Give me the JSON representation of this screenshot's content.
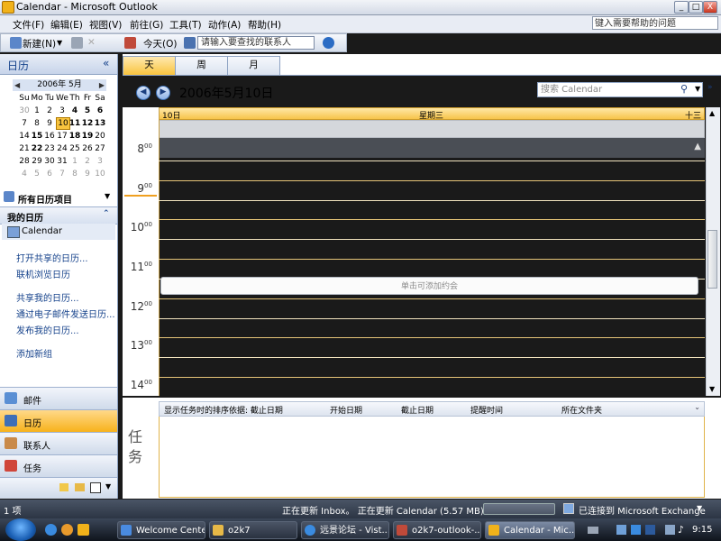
{
  "window": {
    "title": "Calendar - Microsoft Outlook",
    "minimize": "_",
    "maximize": "□",
    "close": "X"
  },
  "menu": {
    "items": [
      "文件(F)",
      "编辑(E)",
      "视图(V)",
      "前往(G)",
      "工具(T)",
      "动作(A)",
      "帮助(H)"
    ],
    "help_placeholder": "键入需要帮助的问题"
  },
  "toolbar": {
    "new_label": "新建(N)",
    "today_label": "今天(O)",
    "contact_placeholder": "请输入要查找的联系人"
  },
  "nav": {
    "title": "日历",
    "collapse_icon": "«",
    "mini_calendar": {
      "month": "2006年 5月",
      "weekdays": [
        "Su",
        "Mo",
        "Tu",
        "We",
        "Th",
        "Fr",
        "Sa"
      ],
      "weeks": [
        [
          "30",
          "1",
          "2",
          "3",
          "4",
          "5",
          "6"
        ],
        [
          "7",
          "8",
          "9",
          "10",
          "11",
          "12",
          "13"
        ],
        [
          "14",
          "15",
          "16",
          "17",
          "18",
          "19",
          "20"
        ],
        [
          "21",
          "22",
          "23",
          "24",
          "25",
          "26",
          "27"
        ],
        [
          "28",
          "29",
          "30",
          "31",
          "1",
          "2",
          "3"
        ],
        [
          "4",
          "5",
          "6",
          "7",
          "8",
          "9",
          "10"
        ]
      ],
      "selected": "10"
    },
    "all_items": "所有日历项目",
    "my_calendars": "我的日历",
    "calendar_item": "Calendar",
    "links": [
      "打开共享的日历...",
      "联机浏览日历",
      "共享我的日历...",
      "通过电子邮件发送日历...",
      "发布我的日历...",
      "添加新组"
    ],
    "buttons": [
      "邮件",
      "日历",
      "联系人",
      "任务"
    ]
  },
  "view": {
    "tabs": [
      "天",
      "周",
      "月"
    ],
    "active_tab": "天",
    "date_title": "2006年5月10日",
    "search_placeholder": "搜索 Calendar",
    "day_number": "10日",
    "weekday": "星期三",
    "lunar": "十三",
    "hours": [
      "8",
      "9",
      "10",
      "11",
      "12",
      "13",
      "14"
    ],
    "minute": "00",
    "add_appointment": "单击可添加约会"
  },
  "tasks": {
    "label": "任务",
    "columns": [
      "显示任务时的排序依据: 截止日期",
      "开始日期",
      "截止日期",
      "提醒时间",
      "所在文件夹"
    ]
  },
  "status": {
    "items": "1 项",
    "updating": "正在更新 Inbox。 正在更新 Calendar (5.57 MB)。",
    "connection": "已连接到 Microsoft Exchange"
  },
  "taskbar": {
    "buttons": [
      "Welcome Center",
      "o2k7",
      "远景论坛 - Vist...",
      "o2k7-outlook-...",
      "Calendar - Mic..."
    ],
    "time": "9:15"
  }
}
